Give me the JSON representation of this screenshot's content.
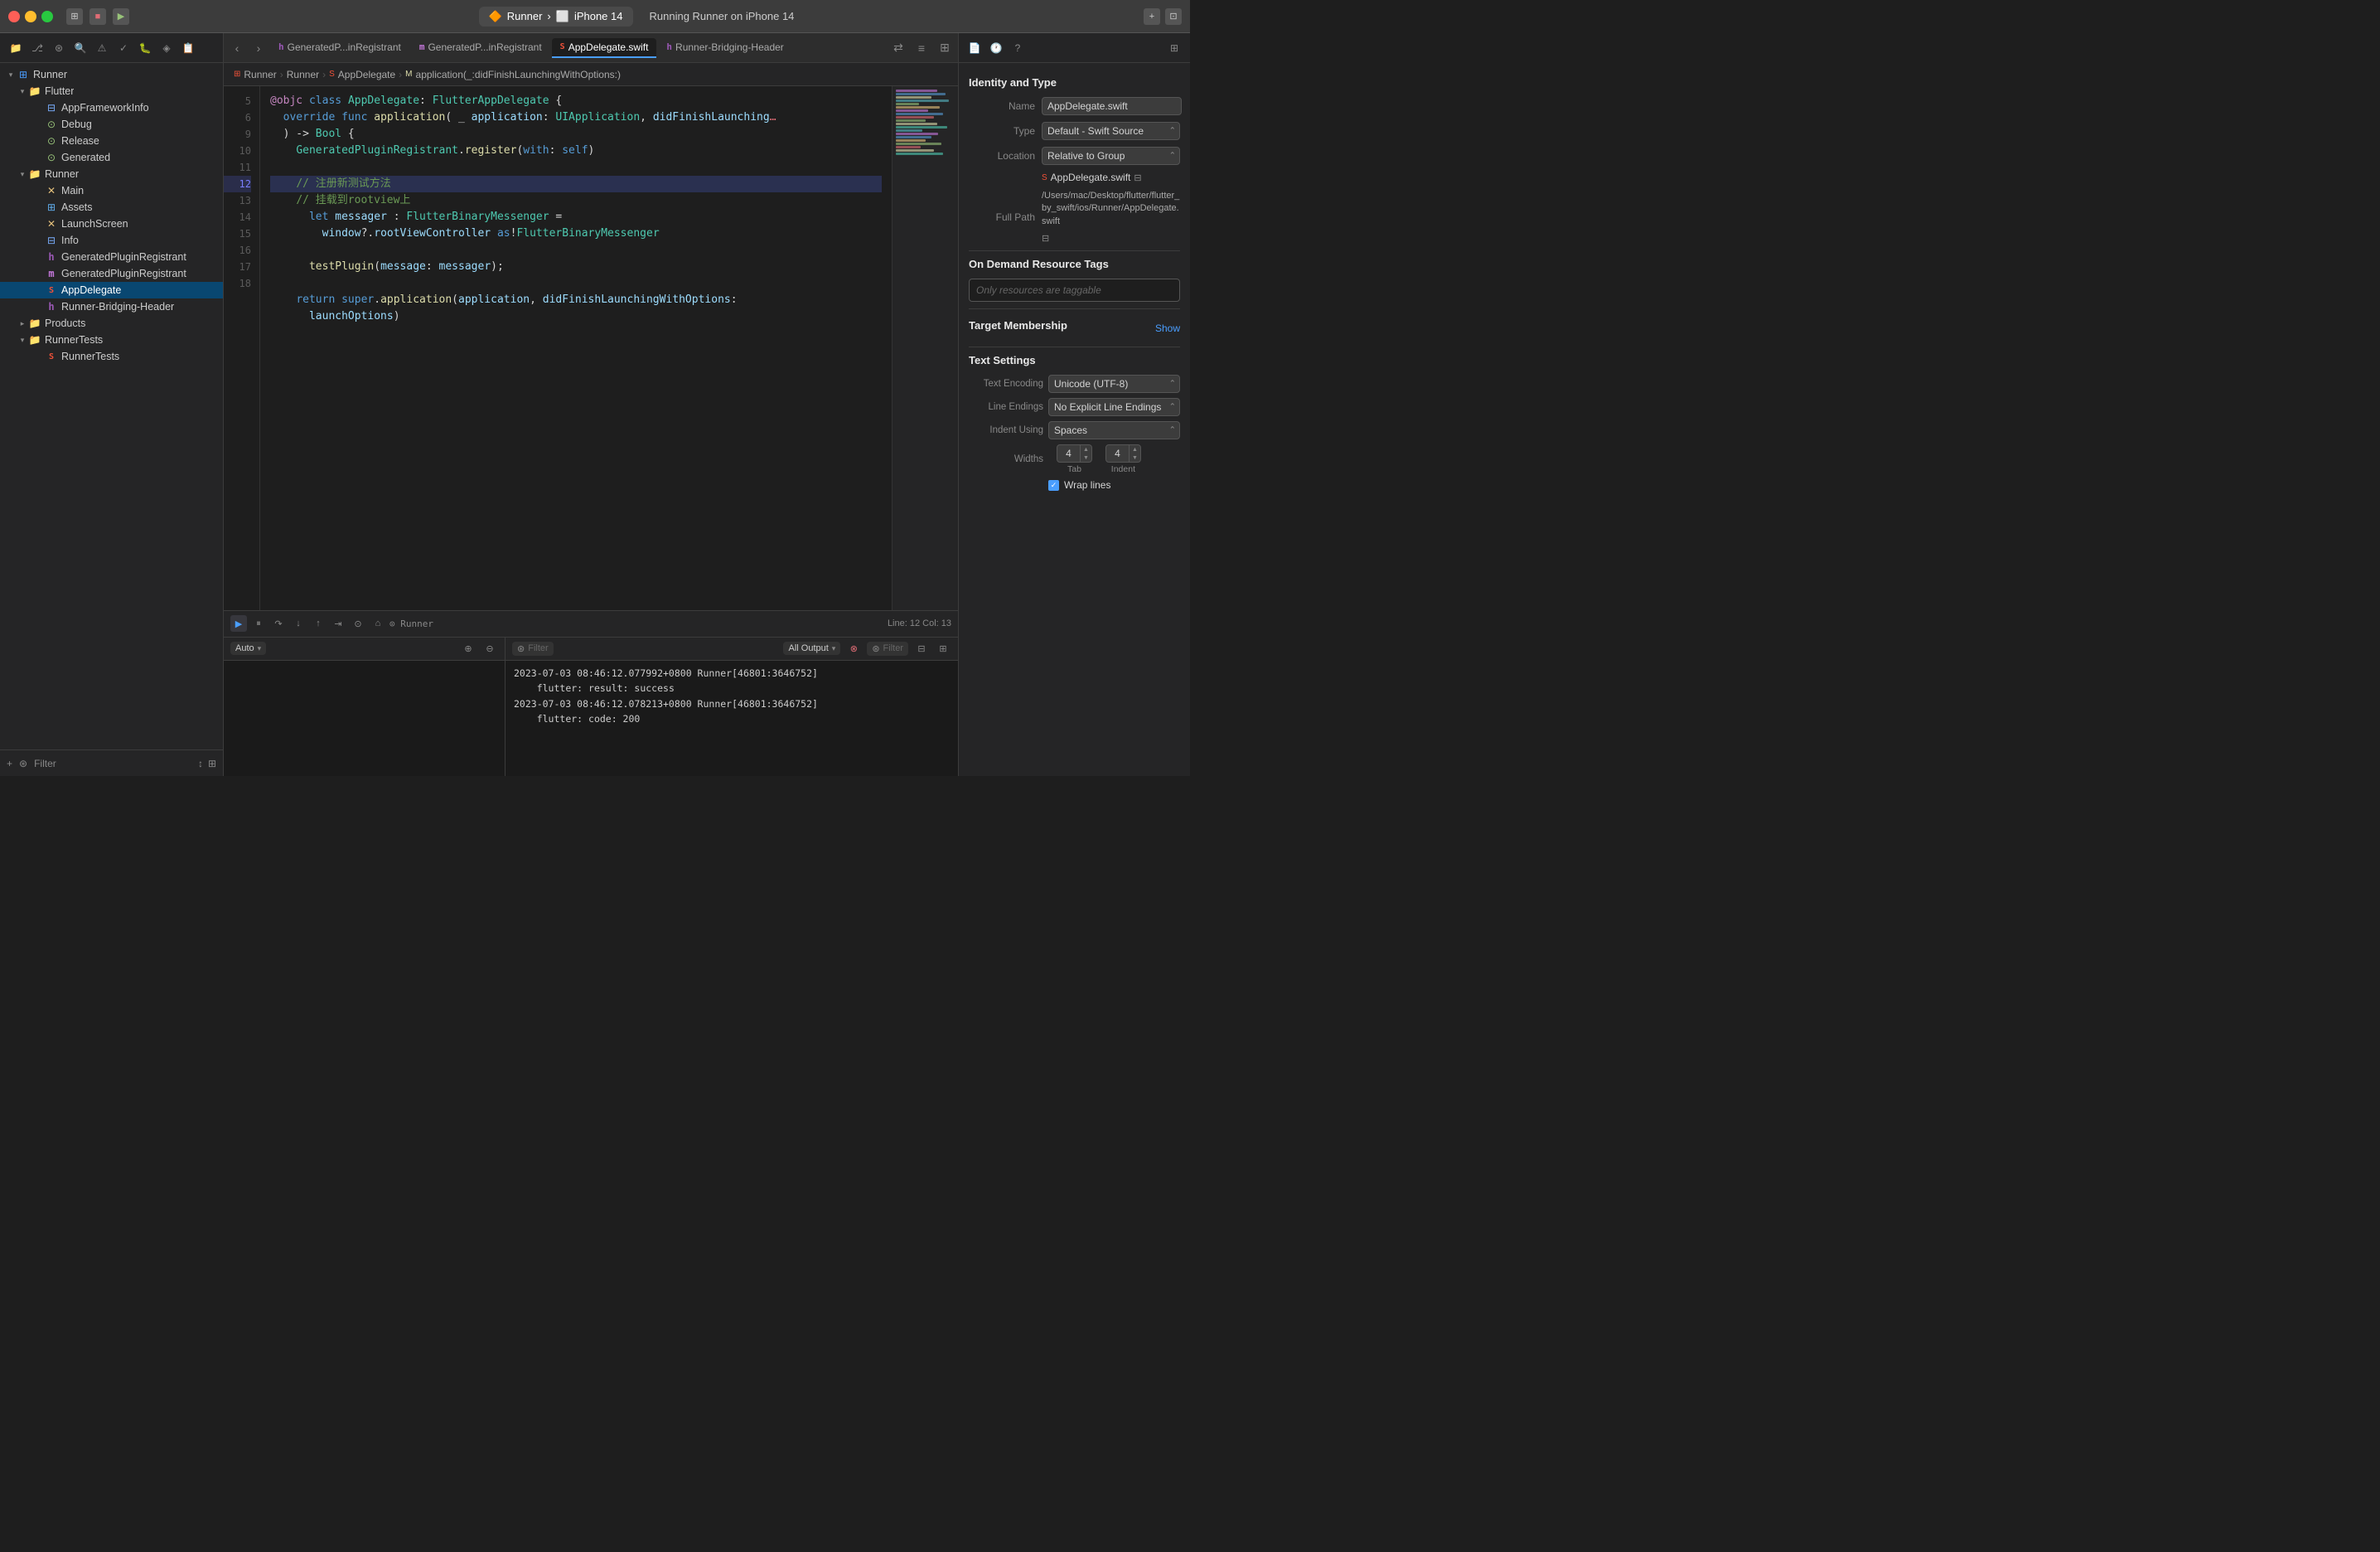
{
  "titleBar": {
    "projectName": "Runner",
    "runnerLabel": "Runner",
    "separator": "›",
    "scheme": "iPhone 14",
    "runStatus": "Running Runner on iPhone 14",
    "addBtnLabel": "+",
    "stopBtn": "■",
    "playBtn": "▶"
  },
  "tabs": {
    "items": [
      {
        "icon": "h",
        "label": "GeneratedP...inRegistrant",
        "active": false,
        "color": "#9b59b6"
      },
      {
        "icon": "m",
        "label": "GeneratedP...inRegistrant",
        "active": false,
        "color": "#c678dd"
      },
      {
        "icon": "swift",
        "label": "AppDelegate",
        "active": true,
        "color": "#f05138"
      },
      {
        "icon": "h",
        "label": "Runner-Bridging-Header",
        "active": false,
        "color": "#9b59b6"
      }
    ]
  },
  "breadcrumb": {
    "parts": [
      "Runner",
      "Runner",
      "AppDelegate",
      "application(_:didFinishLaunchingWithOptions:)"
    ]
  },
  "codeLines": [
    {
      "num": 5,
      "highlighted": false
    },
    {
      "num": 6,
      "highlighted": false
    },
    {
      "num": 9,
      "highlighted": false
    },
    {
      "num": 10,
      "highlighted": false
    },
    {
      "num": 11,
      "highlighted": false
    },
    {
      "num": 12,
      "highlighted": true
    },
    {
      "num": 13,
      "highlighted": false
    },
    {
      "num": 14,
      "highlighted": false
    },
    {
      "num": 15,
      "highlighted": false
    },
    {
      "num": 16,
      "highlighted": false
    },
    {
      "num": 17,
      "highlighted": false
    },
    {
      "num": 18,
      "highlighted": false
    }
  ],
  "statusBar": {
    "lineCol": "Line: 12  Col: 13",
    "label": "Runner"
  },
  "console": {
    "lines": [
      "2023-07-03 08:46:12.077992+0800 Runner[46801:3646752]",
      "    flutter: result: success",
      "2023-07-03 08:46:12.078213+0800 Runner[46801:3646752]",
      "    flutter: code: 200"
    ],
    "autoLabel": "Auto",
    "outputLabel": "All Output",
    "filterPlaceholder": "Filter"
  },
  "inspector": {
    "title": "Identity and Type",
    "name": {
      "label": "Name",
      "value": "AppDelegate.swift"
    },
    "type": {
      "label": "Type",
      "value": "Default - Swift Source"
    },
    "location": {
      "label": "Location",
      "value": "Relative to Group"
    },
    "fileRef": {
      "value": "AppDelegate.swift"
    },
    "fullPath": {
      "label": "Full Path",
      "value": "/Users/mac/Desktop/flutter/flutter_by_swift/ios/Runner/AppDelegate.swift"
    },
    "onDemand": {
      "title": "On Demand Resource Tags"
    },
    "tagsPlaceholder": "Only resources are taggable",
    "targetMembership": {
      "title": "Target Membership"
    },
    "showLabel": "Show",
    "textSettings": {
      "title": "Text Settings"
    },
    "textEncoding": {
      "label": "Text Encoding",
      "value": "Unicode (UTF-8)"
    },
    "lineEndings": {
      "label": "Line Endings",
      "value": "No Explicit Line Endings"
    },
    "indentUsing": {
      "label": "Indent Using",
      "value": "Spaces"
    },
    "widths": {
      "label": "Widths"
    },
    "tabWidth": "4",
    "indentWidth": "4",
    "tabLabel": "Tab",
    "indentLabel": "Indent",
    "wrapLines": {
      "label": "Wrap lines",
      "checked": true
    }
  },
  "sidebar": {
    "root": {
      "label": "Runner",
      "children": [
        {
          "label": "Flutter",
          "icon": "folder",
          "children": [
            {
              "label": "AppFrameworkInfo",
              "icon": "plist"
            },
            {
              "label": "Debug",
              "icon": "xcconfig"
            },
            {
              "label": "Release",
              "icon": "xcconfig"
            },
            {
              "label": "Generated",
              "icon": "xcconfig"
            }
          ]
        },
        {
          "label": "Runner",
          "icon": "folder",
          "children": [
            {
              "label": "Main",
              "icon": "storyboard"
            },
            {
              "label": "Assets",
              "icon": "assets"
            },
            {
              "label": "LaunchScreen",
              "icon": "storyboard"
            },
            {
              "label": "Info",
              "icon": "plist"
            },
            {
              "label": "GeneratedPluginRegistrant",
              "icon": "header"
            },
            {
              "label": "GeneratedPluginRegistrant",
              "icon": "m"
            },
            {
              "label": "AppDelegate",
              "icon": "swift",
              "active": true
            },
            {
              "label": "Runner-Bridging-Header",
              "icon": "header"
            }
          ]
        },
        {
          "label": "Products",
          "icon": "folder-products"
        },
        {
          "label": "RunnerTests",
          "icon": "folder",
          "children": [
            {
              "label": "RunnerTests",
              "icon": "swift"
            }
          ]
        }
      ]
    }
  }
}
